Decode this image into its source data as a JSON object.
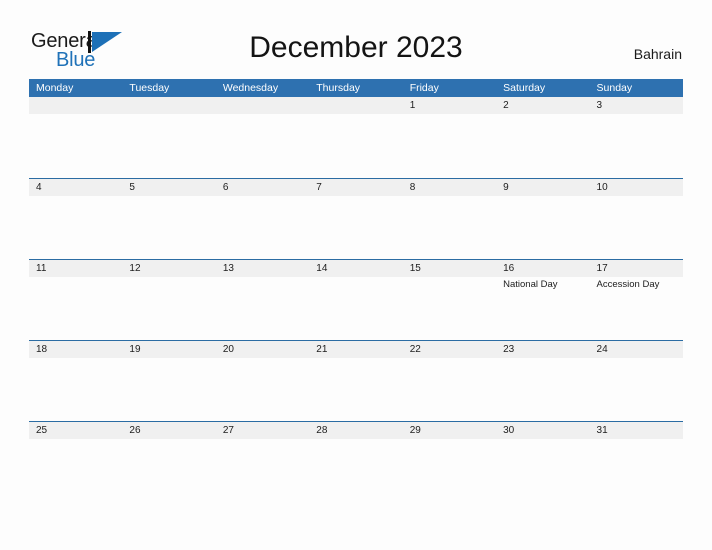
{
  "brand": {
    "name_part1": "General",
    "name_part2": "Blue",
    "mark_icon": "triangle-flag-icon"
  },
  "header": {
    "title": "December 2023",
    "country": "Bahrain"
  },
  "calendar": {
    "weekdays": [
      "Monday",
      "Tuesday",
      "Wednesday",
      "Thursday",
      "Friday",
      "Saturday",
      "Sunday"
    ],
    "weeks": [
      [
        {
          "day": "",
          "event": ""
        },
        {
          "day": "",
          "event": ""
        },
        {
          "day": "",
          "event": ""
        },
        {
          "day": "",
          "event": ""
        },
        {
          "day": "1",
          "event": ""
        },
        {
          "day": "2",
          "event": ""
        },
        {
          "day": "3",
          "event": ""
        }
      ],
      [
        {
          "day": "4",
          "event": ""
        },
        {
          "day": "5",
          "event": ""
        },
        {
          "day": "6",
          "event": ""
        },
        {
          "day": "7",
          "event": ""
        },
        {
          "day": "8",
          "event": ""
        },
        {
          "day": "9",
          "event": ""
        },
        {
          "day": "10",
          "event": ""
        }
      ],
      [
        {
          "day": "11",
          "event": ""
        },
        {
          "day": "12",
          "event": ""
        },
        {
          "day": "13",
          "event": ""
        },
        {
          "day": "14",
          "event": ""
        },
        {
          "day": "15",
          "event": ""
        },
        {
          "day": "16",
          "event": "National Day"
        },
        {
          "day": "17",
          "event": "Accession Day"
        }
      ],
      [
        {
          "day": "18",
          "event": ""
        },
        {
          "day": "19",
          "event": ""
        },
        {
          "day": "20",
          "event": ""
        },
        {
          "day": "21",
          "event": ""
        },
        {
          "day": "22",
          "event": ""
        },
        {
          "day": "23",
          "event": ""
        },
        {
          "day": "24",
          "event": ""
        }
      ],
      [
        {
          "day": "25",
          "event": ""
        },
        {
          "day": "26",
          "event": ""
        },
        {
          "day": "27",
          "event": ""
        },
        {
          "day": "28",
          "event": ""
        },
        {
          "day": "29",
          "event": ""
        },
        {
          "day": "30",
          "event": ""
        },
        {
          "day": "31",
          "event": ""
        }
      ]
    ]
  },
  "colors": {
    "header_blue": "#2e71b0",
    "row_border_blue": "#2b6ca3",
    "brand_blue": "#2072b8",
    "day_band_gray": "#f0f0f0",
    "page_background": "#fdfdfd"
  }
}
